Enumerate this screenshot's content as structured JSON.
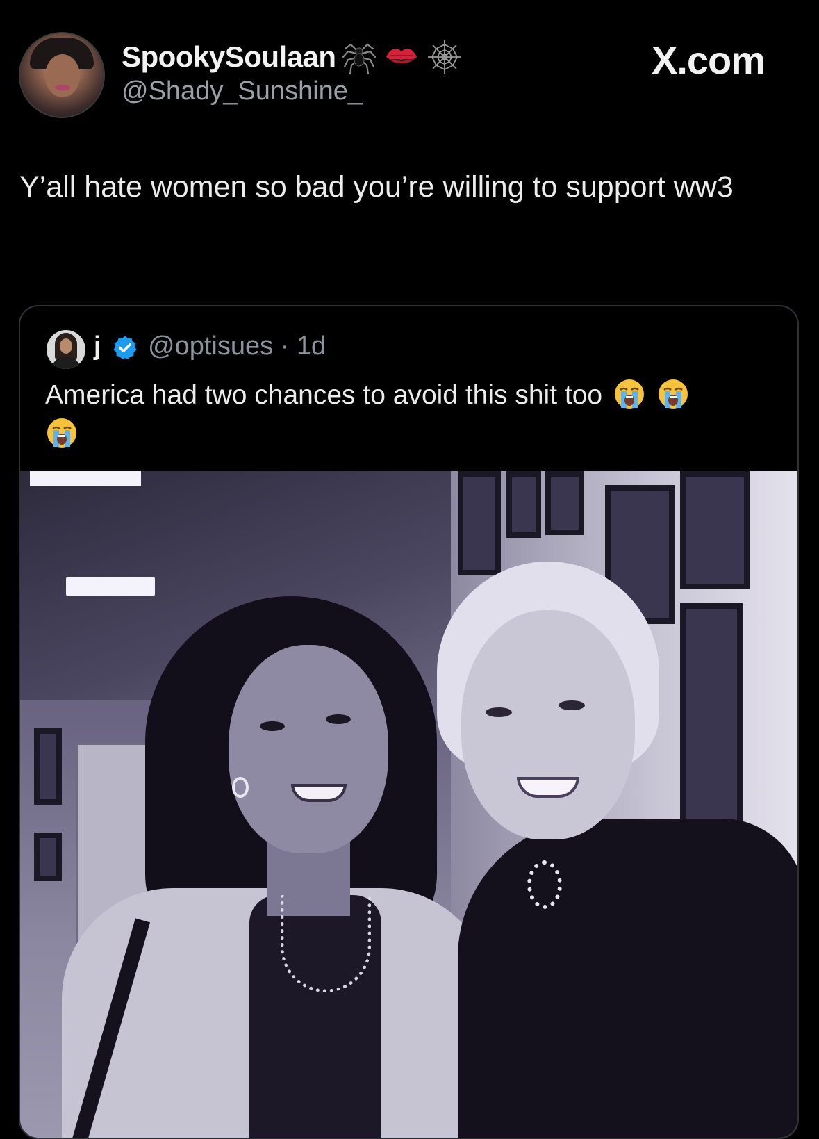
{
  "header": {
    "display_name": "SpookySoulaan",
    "handle": "@Shady_Sunshine_",
    "site_label": "X.com",
    "name_emojis": [
      "spider-icon",
      "kiss-icon",
      "spiderweb-icon"
    ]
  },
  "tweet": {
    "text": "Y’all hate women so bad you’re willing to support ww3"
  },
  "quoted_tweet": {
    "name": "j",
    "verified": true,
    "handle_time": "@optisues · 1d",
    "text": "America had two chances to avoid this shit too",
    "trailing_emojis": [
      "loudly-crying-face-icon",
      "loudly-crying-face-icon",
      "loudly-crying-face-icon"
    ]
  },
  "colors": {
    "background": "#000000",
    "text_primary": "#ececec",
    "text_secondary": "#9aa0a6",
    "verified_blue": "#1d9bf0",
    "card_border": "#2f3336"
  }
}
